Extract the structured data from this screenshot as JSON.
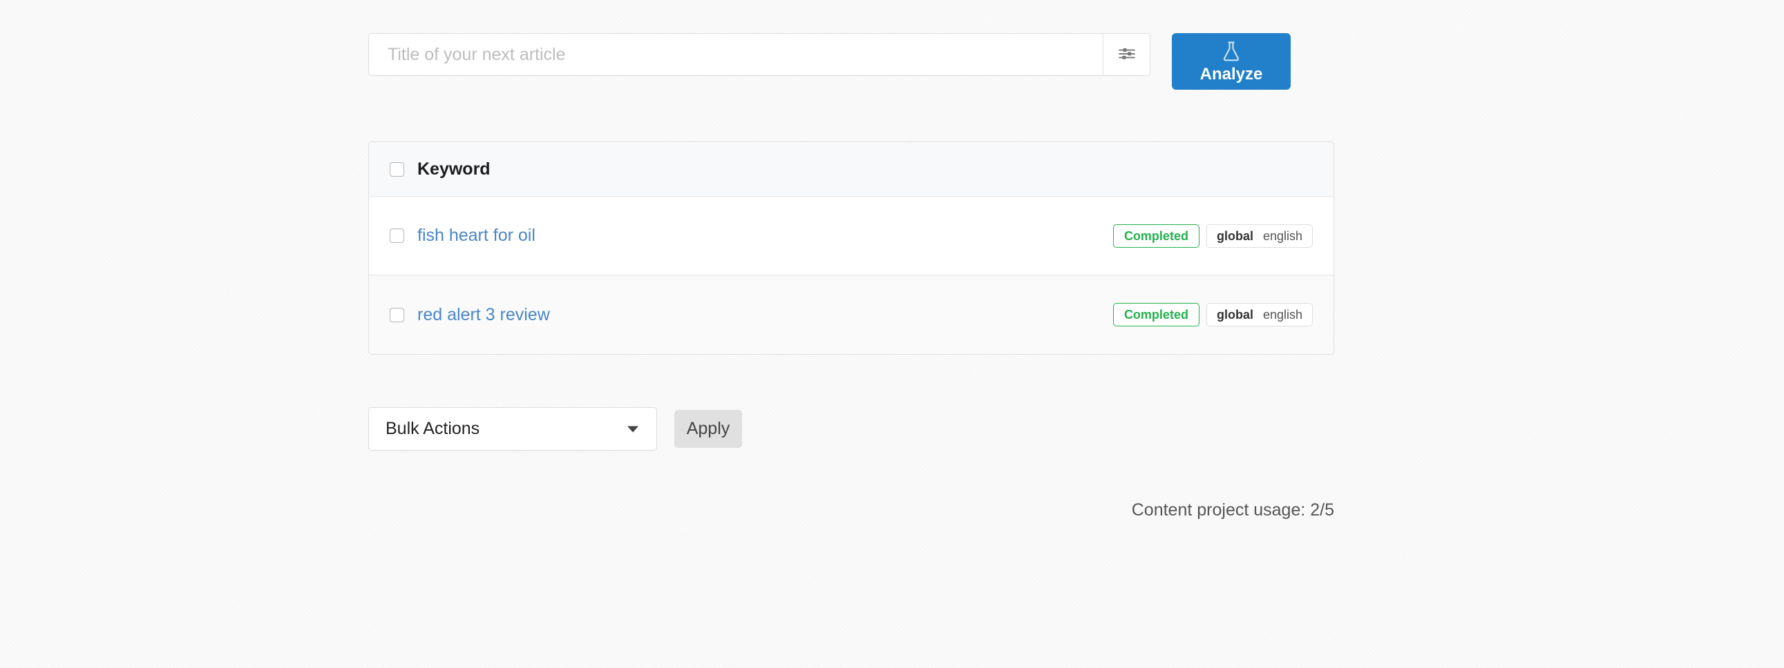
{
  "search": {
    "placeholder": "Title of your next article",
    "value": "",
    "settings_icon": "sliders-icon"
  },
  "analyze": {
    "label": "Analyze",
    "icon": "flask-icon",
    "color": "#2180c9"
  },
  "table": {
    "header": {
      "keyword_label": "Keyword"
    },
    "rows": [
      {
        "keyword": "fish heart for oil",
        "status": "Completed",
        "status_color": "#22b14c",
        "location": "global",
        "language": "english"
      },
      {
        "keyword": "red alert 3 review",
        "status": "Completed",
        "status_color": "#22b14c",
        "location": "global",
        "language": "english"
      }
    ]
  },
  "bulk": {
    "selected": "Bulk Actions",
    "options": [
      "Bulk Actions"
    ],
    "apply_label": "Apply"
  },
  "footer": {
    "usage": "Content project usage: 2/5"
  }
}
